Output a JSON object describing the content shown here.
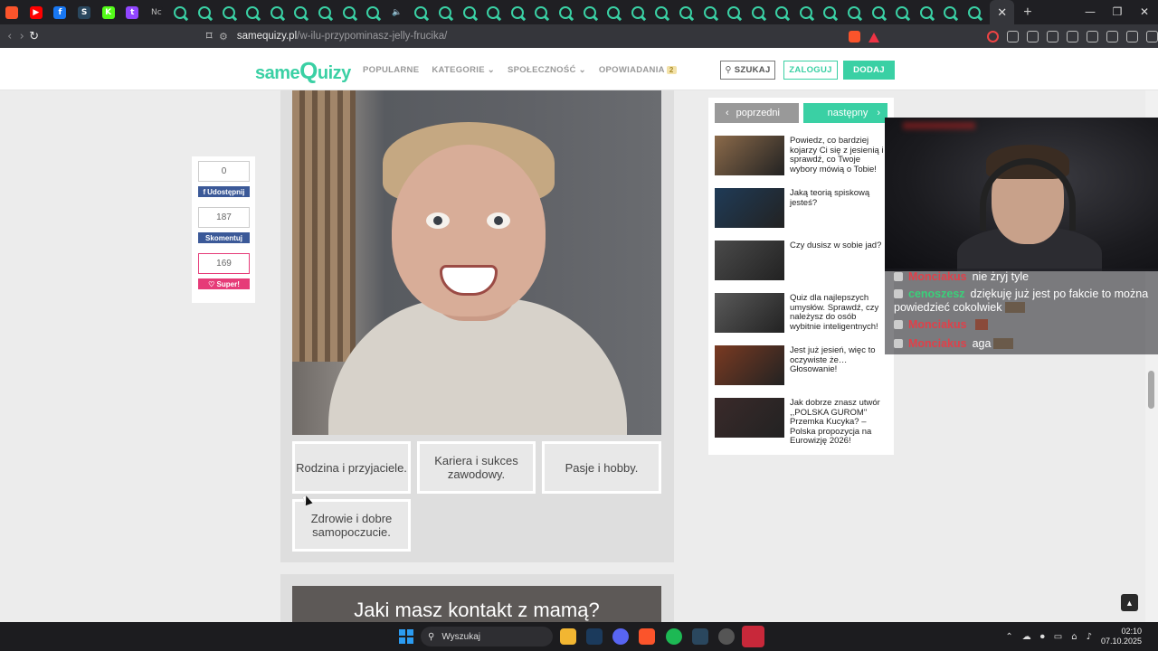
{
  "browser": {
    "tabs": [
      {
        "icon": "brave-icon",
        "color": "#fb542b",
        "glyph": ""
      },
      {
        "icon": "youtube-icon",
        "color": "#ff0000",
        "glyph": "▶"
      },
      {
        "icon": "facebook-icon",
        "color": "#1877f2",
        "glyph": "f"
      },
      {
        "icon": "steam-icon",
        "color": "#2a475e",
        "glyph": "S"
      },
      {
        "icon": "kick-icon",
        "color": "#53fc18",
        "glyph": "K"
      },
      {
        "icon": "twitch-icon",
        "color": "#9146ff",
        "glyph": "t"
      },
      {
        "icon": "text-tab",
        "color": "#1f1f23",
        "glyph": "Nc"
      }
    ],
    "quiz_tab_count": 35,
    "url_host": "samequizy.pl",
    "url_path": "/w-ilu-przypominasz-jelly-frucika/"
  },
  "site": {
    "logo_pre": "same",
    "logo_q": "Q",
    "logo_post": "uizy",
    "menu": [
      "POPULARNE",
      "KATEGORIE ⌄",
      "SPOŁECZNOŚĆ ⌄",
      "OPOWIADANIA"
    ],
    "stories_badge": "2",
    "search_label": "SZUKAJ",
    "login_label": "ZALOGUJ",
    "add_label": "DODAJ",
    "brand_color": "#3ad0a4"
  },
  "share": {
    "share_count": "0",
    "share_label": "Udostępnij",
    "comment_count": "187",
    "comment_label": "Skomentuj",
    "super_count": "169",
    "super_label": "♡ Super!"
  },
  "question": {
    "answers": [
      "Rodzina i przyjaciele.",
      "Kariera i sukces zawodowy.",
      "Pasje i hobby.",
      "Zdrowie i dobre samopoczucie."
    ],
    "next_question": "Jaki masz kontakt z mamą?"
  },
  "sidebar": {
    "prev_label": "poprzedni",
    "next_label": "następny",
    "quizzes": [
      {
        "title": "Powiedz, co bardziej kojarzy Ci się z jesienią i sprawdź, co Twoje wybory mówią o Tobie!",
        "thumb": "#8b6a4a"
      },
      {
        "title": "Jaką teorią spiskową jesteś?",
        "thumb": "#1f3b57"
      },
      {
        "title": "Czy dusisz w sobie jad?",
        "thumb": "#4a4a4a"
      },
      {
        "title": "Quiz dla najlepszych umysłów. Sprawdź, czy należysz do osób wybitnie inteligentnych!",
        "thumb": "#5a5a5a"
      },
      {
        "title": "Jest już jesień, więc to oczywiste że… Głosowanie!",
        "thumb": "#7a3a22"
      },
      {
        "title": "Jak dobrze znasz utwór ,,POLSKA GUROM\" Przemka Kucyka? – Polska propozycja na Eurowizję 2026!",
        "thumb": "#3a2a2a"
      }
    ]
  },
  "chat": [
    {
      "name": "Monciakus",
      "name_color": "#e0404a",
      "text": "nie żryj tyle",
      "emote": ""
    },
    {
      "name": "cenoszesz",
      "name_color": "#3ad07a",
      "text": "dziękuję już jest po fakcie to można powiedzieć cokolwiek",
      "emote": "wide"
    },
    {
      "name": "Monciakus",
      "name_color": "#e0404a",
      "text": "",
      "emote": "small"
    },
    {
      "name": "Monciakus",
      "name_color": "#e0404a",
      "text": "aga",
      "emote": "wide"
    }
  ],
  "taskbar": {
    "search_placeholder": "Wyszukaj",
    "time": "02:10",
    "date": "07.10.2025"
  }
}
